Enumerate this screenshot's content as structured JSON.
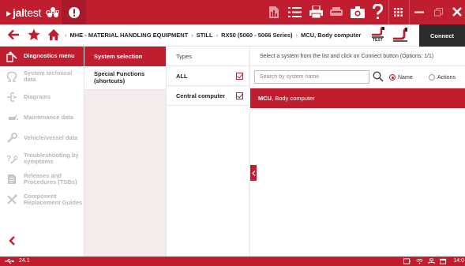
{
  "app": {
    "logo_bold": "jal",
    "logo_light": "test",
    "logo_sub": "GRP",
    "accent_color": "#c01d2e"
  },
  "topbar": {
    "icons": [
      "warning-icon",
      "report-icon",
      "list-icon",
      "print-icon",
      "vehicle-icon",
      "camera-icon",
      "help-icon",
      "apps-grid-icon",
      "minimize-icon",
      "restore-icon",
      "close-icon"
    ]
  },
  "breadcrumb": {
    "items": [
      "MHE - MATERIAL HANDLING EQUIPMENT",
      "STILL",
      "RX50 (5060 - 5066 Series)",
      "MCU, Body computer"
    ]
  },
  "navbar": {
    "test_label": "TEST",
    "connect_label": "Connect"
  },
  "sidebar": {
    "items": [
      {
        "label": "Diagnostics menu",
        "icon": "diagnostics-icon",
        "active": true
      },
      {
        "label": "System technical data",
        "icon": "ohm-icon",
        "active": false
      },
      {
        "label": "Diagrams",
        "icon": "diagram-icon",
        "active": false
      },
      {
        "label": "Maintenance data",
        "icon": "oil-can-icon",
        "active": false
      },
      {
        "label": "Vehicle/vessel data",
        "icon": "wrench-icon",
        "active": false
      },
      {
        "label": "Troubleshooting by symptoms",
        "icon": "troubleshoot-icon",
        "active": false
      },
      {
        "label": "Releases and Procedures (TSBs)",
        "icon": "document-icon",
        "active": false
      },
      {
        "label": "Component Replacement Guides",
        "icon": "tools-icon",
        "active": false
      }
    ]
  },
  "col1": {
    "header": "System selection",
    "items": [
      "Special Functions (shortcuts)"
    ]
  },
  "col2": {
    "header": "Types",
    "rows": [
      {
        "label": "ALL",
        "checked": true
      },
      {
        "label": "Central computer",
        "checked": true
      }
    ]
  },
  "col3": {
    "header": "Select a system from the list and click on Connect button (Options: 1/1)",
    "search_placeholder": "Search by system name",
    "radio_name": "Name",
    "radio_actions": "Actions",
    "systems": [
      {
        "code": "MCU",
        "name": ", Body computer"
      }
    ]
  },
  "status": {
    "version": "24.1",
    "time": "14:0"
  }
}
